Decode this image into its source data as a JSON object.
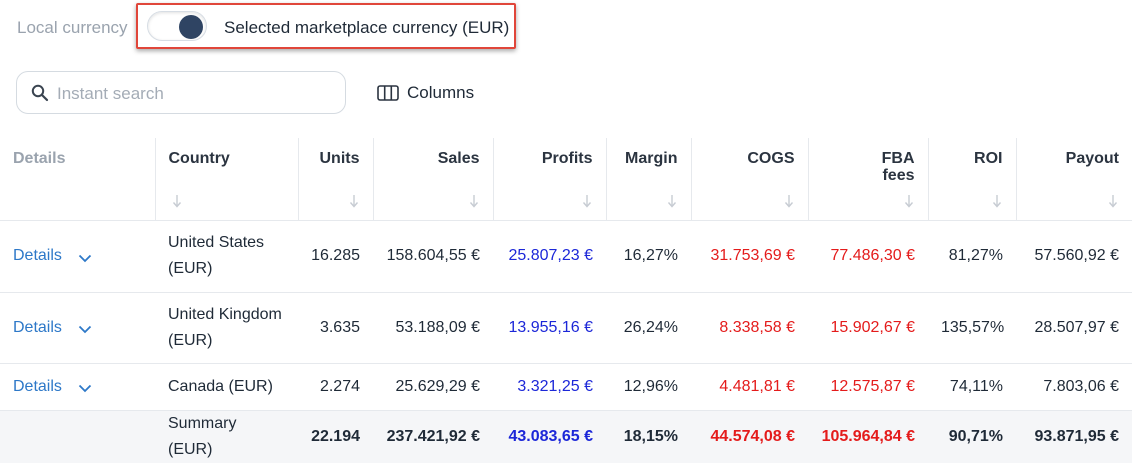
{
  "currency_toggle": {
    "left_label": "Local currency",
    "right_label": "Selected marketplace currency (EUR)",
    "state": "selected-marketplace"
  },
  "search": {
    "placeholder": "Instant search",
    "value": ""
  },
  "columns_button": {
    "label": "Columns"
  },
  "colors": {
    "profit": "#1c27d8",
    "cost": "#e41b1b",
    "link": "#2d78c8",
    "highlight": "#e0463a"
  },
  "table": {
    "headers": [
      "Details",
      "Country",
      "Units",
      "Sales",
      "Profits",
      "Margin",
      "COGS",
      "FBA\nfees",
      "ROI",
      "Payout"
    ],
    "rows": [
      {
        "details": "Details",
        "country": "United States (EUR)",
        "units": "16.285",
        "sales": "158.604,55 €",
        "profits": "25.807,23 €",
        "margin": "16,27%",
        "cogs": "31.753,69 €",
        "fba_fees": "77.486,30 €",
        "roi": "81,27%",
        "payout": "57.560,92 €"
      },
      {
        "details": "Details",
        "country": "United Kingdom (EUR)",
        "units": "3.635",
        "sales": "53.188,09 €",
        "profits": "13.955,16 €",
        "margin": "26,24%",
        "cogs": "8.338,58 €",
        "fba_fees": "15.902,67 €",
        "roi": "135,57%",
        "payout": "28.507,97 €"
      },
      {
        "details": "Details",
        "country": "Canada (EUR)",
        "units": "2.274",
        "sales": "25.629,29 €",
        "profits": "3.321,25 €",
        "margin": "12,96%",
        "cogs": "4.481,81 €",
        "fba_fees": "12.575,87 €",
        "roi": "74,11%",
        "payout": "7.803,06 €"
      }
    ],
    "summary": {
      "country": "Summary (EUR)",
      "units": "22.194",
      "sales": "237.421,92 €",
      "profits": "43.083,65 €",
      "margin": "18,15%",
      "cogs": "44.574,08 €",
      "fba_fees": "105.964,84 €",
      "roi": "90,71%",
      "payout": "93.871,95 €"
    }
  }
}
